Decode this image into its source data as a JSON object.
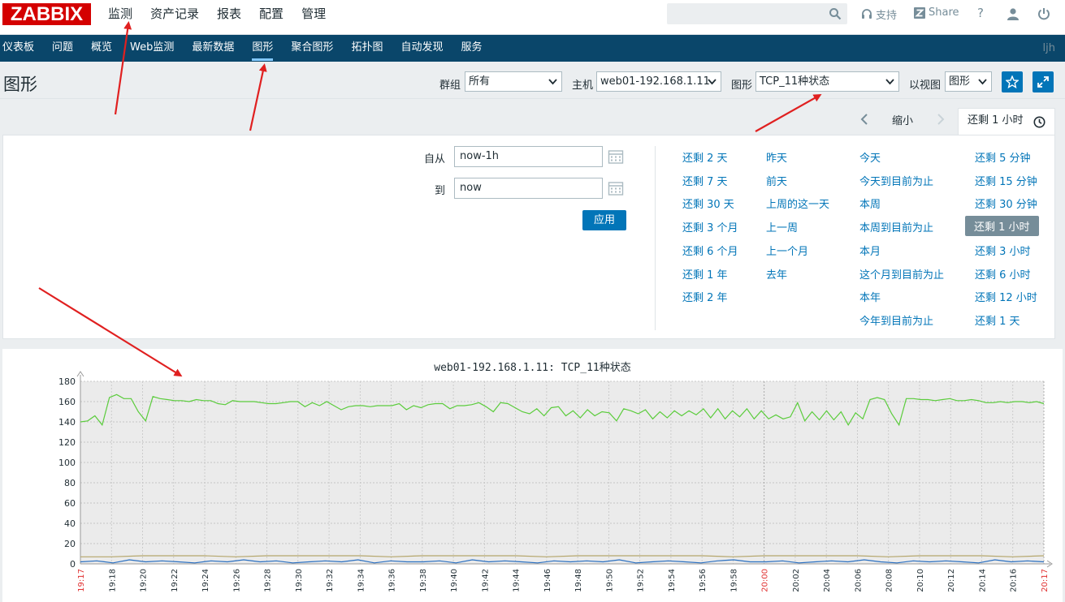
{
  "brand": {
    "logo": "ZABBIX"
  },
  "top_menu": [
    {
      "label": "监测"
    },
    {
      "label": "资产记录"
    },
    {
      "label": "报表"
    },
    {
      "label": "配置"
    },
    {
      "label": "管理"
    }
  ],
  "top_right": {
    "support": "支持",
    "share": "Share",
    "help": "?"
  },
  "sub_menu": [
    {
      "label": "仪表板"
    },
    {
      "label": "问题"
    },
    {
      "label": "概览"
    },
    {
      "label": "Web监测"
    },
    {
      "label": "最新数据"
    },
    {
      "label": "图形"
    },
    {
      "label": "聚合图形"
    },
    {
      "label": "拓扑图"
    },
    {
      "label": "自动发现"
    },
    {
      "label": "服务"
    }
  ],
  "user": "ljh",
  "header": {
    "title": "图形",
    "group_label": "群组",
    "group_value": "所有",
    "host_label": "主机",
    "host_value": "web01-192.168.1.11",
    "graph_label": "图形",
    "graph_value": "TCP_11种状态",
    "view_label": "以视图",
    "view_value": "图形"
  },
  "time_tabs": {
    "zoom_out": "缩小",
    "active_tab": "还剩 1 小时"
  },
  "filter": {
    "from_label": "自从",
    "from_value": "now-1h",
    "to_label": "到",
    "to_value": "now",
    "apply": "应用"
  },
  "quick_ranges": {
    "col1": [
      "还剩 2 天",
      "还剩 7 天",
      "还剩 30 天",
      "还剩 3 个月",
      "还剩 6 个月",
      "还剩 1 年",
      "还剩 2 年"
    ],
    "col2": [
      "昨天",
      "前天",
      "上周的这一天",
      "上一周",
      "上一个月",
      "去年"
    ],
    "col3": [
      "今天",
      "今天到目前为止",
      "本周",
      "本周到目前为止",
      "本月",
      "这个月到目前为止",
      "本年",
      "今年到目前为止"
    ],
    "col4": [
      "还剩 5 分钟",
      "还剩 15 分钟",
      "还剩 30 分钟",
      "还剩 1 小时",
      "还剩 3 小时",
      "还剩 6 小时",
      "还剩 12 小时",
      "还剩 1 天"
    ],
    "selected": "还剩 1 小时"
  },
  "colors": {
    "accent": "#0275b8",
    "nav": "#0a466a",
    "brand": "#d40000",
    "series_green": "#5bcc3c",
    "series_olive": "#b5a66b",
    "series_blue": "#2a6fc0",
    "arrow": "#e02020"
  },
  "chart_data": {
    "type": "line",
    "title": "web01-192.168.1.11: TCP_11种状态",
    "ylim": [
      0,
      180
    ],
    "yticks": [
      0,
      20,
      40,
      60,
      80,
      100,
      120,
      140,
      160,
      180
    ],
    "x_tick_labels": [
      "19:17",
      "19:18",
      "19:20",
      "19:22",
      "19:24",
      "19:26",
      "19:28",
      "19:30",
      "19:32",
      "19:34",
      "19:36",
      "19:38",
      "19:40",
      "19:42",
      "19:44",
      "19:46",
      "19:48",
      "19:50",
      "19:52",
      "19:54",
      "19:56",
      "19:58",
      "20:00",
      "20:02",
      "20:04",
      "20:06",
      "20:08",
      "20:10",
      "20:12",
      "20:14",
      "20:16",
      "20:17"
    ],
    "x_tick_red": [
      "19:17",
      "20:00",
      "20:17"
    ],
    "series": [
      {
        "color": "#5bcc3c",
        "values": [
          140,
          141,
          146,
          137,
          164,
          167,
          163,
          163,
          150,
          141,
          165,
          163,
          162,
          161,
          161,
          160,
          162,
          161,
          161,
          158,
          157,
          161,
          160,
          160,
          160,
          159,
          158,
          158,
          159,
          160,
          160,
          155,
          159,
          156,
          160,
          156,
          152,
          155,
          156,
          156,
          155,
          156,
          156,
          156,
          158,
          152,
          156,
          154,
          157,
          158,
          158,
          153,
          156,
          156,
          157,
          159,
          155,
          150,
          159,
          158,
          154,
          150,
          148,
          153,
          146,
          154,
          155,
          146,
          151,
          144,
          152,
          146,
          150,
          149,
          141,
          153,
          151,
          148,
          152,
          143,
          150,
          144,
          151,
          146,
          151,
          147,
          153,
          144,
          153,
          143,
          151,
          145,
          153,
          143,
          151,
          143,
          147,
          143,
          145,
          159,
          141,
          150,
          142,
          151,
          142,
          150,
          137,
          149,
          143,
          162,
          164,
          162,
          148,
          137,
          163,
          163,
          162,
          162,
          161,
          162,
          163,
          161,
          161,
          162,
          161,
          159,
          159,
          160,
          159,
          160,
          160,
          159,
          160,
          158
        ]
      },
      {
        "color": "#b5a66b",
        "values": [
          7,
          7,
          8,
          8,
          8,
          7,
          8,
          8,
          8,
          8,
          7,
          8,
          8,
          8,
          8,
          7,
          8,
          8,
          8,
          8,
          8,
          7,
          8,
          8,
          8,
          8,
          7,
          8,
          8,
          8,
          7,
          8
        ]
      },
      {
        "color": "#2a6fc0",
        "values": [
          2,
          3,
          1,
          4,
          2,
          3,
          2,
          1,
          3,
          2,
          4,
          2,
          3,
          1,
          2,
          3,
          2,
          4,
          1,
          3,
          2,
          2,
          3,
          1,
          4,
          2,
          3,
          2,
          1,
          3,
          2,
          3,
          2,
          4,
          1,
          2,
          3,
          2,
          1,
          3,
          4,
          2,
          2,
          3,
          1,
          2,
          3,
          2,
          4,
          2,
          1,
          3,
          2,
          3,
          2,
          1,
          4,
          2,
          3,
          2
        ]
      }
    ]
  }
}
